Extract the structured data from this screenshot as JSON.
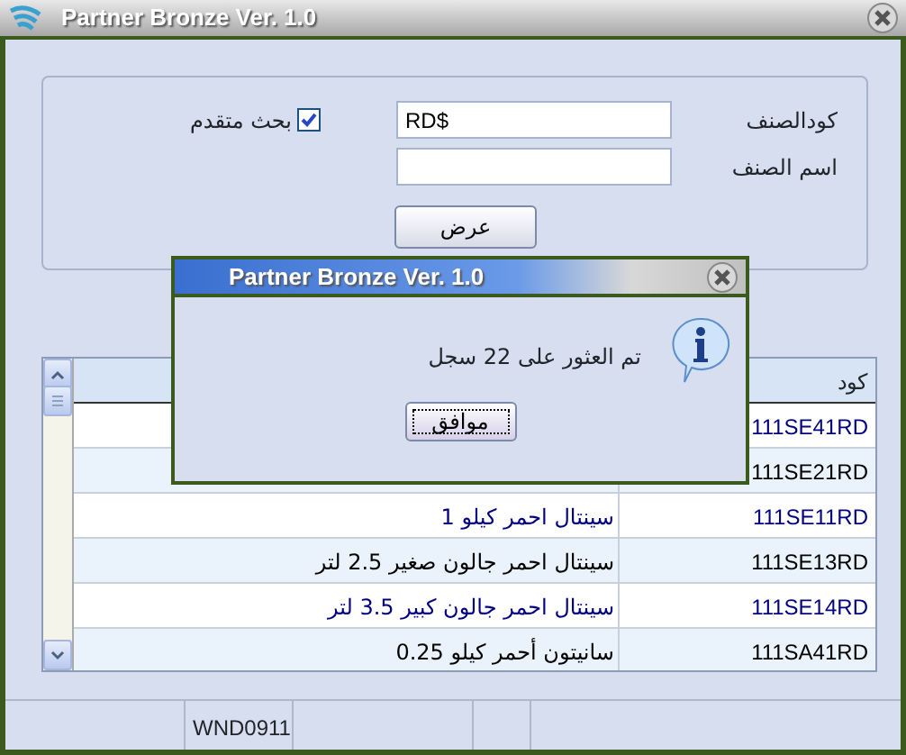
{
  "window": {
    "title": "Partner Bronze Ver. 1.0"
  },
  "search": {
    "fields": [
      {
        "label": "كودالصنف",
        "value": "RD$"
      },
      {
        "label": "اسم الصنف"
      }
    ],
    "advanced": {
      "label": "بحث متقدم",
      "checked": true
    },
    "show_button": "عرض"
  },
  "grid": {
    "columns": [
      "كود"
    ],
    "rows": [
      {
        "code": "111SE41RD",
        "color": "#000080"
      },
      {
        "code": "111SE21RD",
        "color": "#000000"
      },
      {
        "code": "111SE11RD",
        "name": "سينتال احمر كيلو 1",
        "color": "#000080"
      },
      {
        "code": "111SE13RD",
        "name": "سينتال احمر جالون صغير 2.5 لتر",
        "color": "#000000"
      },
      {
        "code": "111SE14RD",
        "name": "سينتال احمر جالون كبير 3.5 لتر",
        "color": "#000080"
      },
      {
        "code": "111SA41RD",
        "name": "سانيتون أحمر كيلو 0.25",
        "color": "#000000"
      }
    ]
  },
  "status_bar": {
    "panel_2": "WND0911"
  },
  "dialog": {
    "title": "Partner Bronze Ver. 1.0",
    "message": "تم العثور على 22 سجل",
    "button": "موافق"
  }
}
